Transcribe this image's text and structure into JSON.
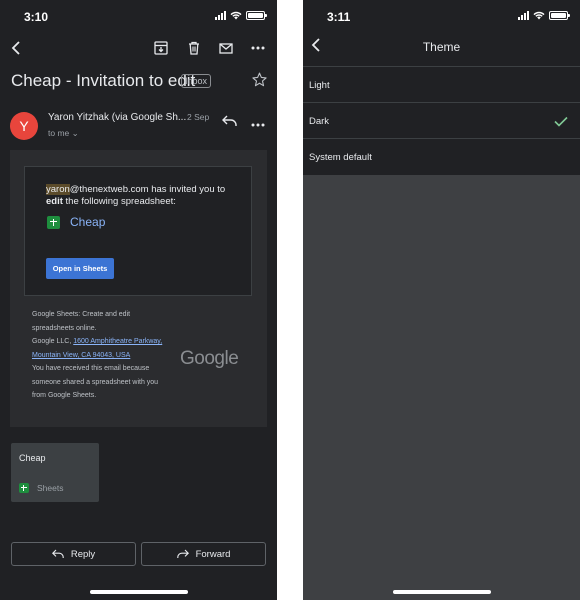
{
  "left": {
    "status_time": "3:10",
    "subject": "Cheap - Invitation to edit",
    "label_badge": "Inbox",
    "sender": "Yaron Yitzhak (via Google Sh...",
    "date": "2 Sep",
    "recipient": "to me",
    "invite": {
      "email_user": "yaron",
      "email_domain": "@thenextweb.com",
      "invited_text": " has invited you to",
      "edit_word": "edit",
      "rest_text": " the following spreadsheet:",
      "doc_name": "Cheap",
      "open_button": "Open in Sheets"
    },
    "footer": {
      "line1": "Google Sheets: Create and edit spreadsheets online.",
      "company": "Google LLC, ",
      "address": "1600 Amphitheatre Parkway, Mountain View, CA 94043, USA",
      "line3": "You have received this email because someone shared a spreadsheet with you from Google Sheets.",
      "logo": "Google"
    },
    "attachment": {
      "title": "Cheap",
      "app": "Sheets"
    },
    "actions": {
      "reply": "Reply",
      "forward": "Forward"
    }
  },
  "right": {
    "status_time": "3:11",
    "title": "Theme",
    "options": [
      {
        "label": "Light",
        "selected": false
      },
      {
        "label": "Dark",
        "selected": true
      },
      {
        "label": "System default",
        "selected": false
      }
    ]
  },
  "colors": {
    "background": "#202124",
    "accent_blue": "#8ab4f8",
    "button_blue": "#3c74d4",
    "avatar_red": "#e8453c",
    "check_green": "#81c995",
    "sheets_green": "#1e8e3e"
  },
  "icons": [
    "back-icon",
    "archive-icon",
    "delete-icon",
    "mail-icon",
    "more-icon",
    "star-icon",
    "reply-icon",
    "forward-icon",
    "check-icon",
    "sheets-icon",
    "signal-icon",
    "wifi-icon",
    "battery-icon"
  ]
}
